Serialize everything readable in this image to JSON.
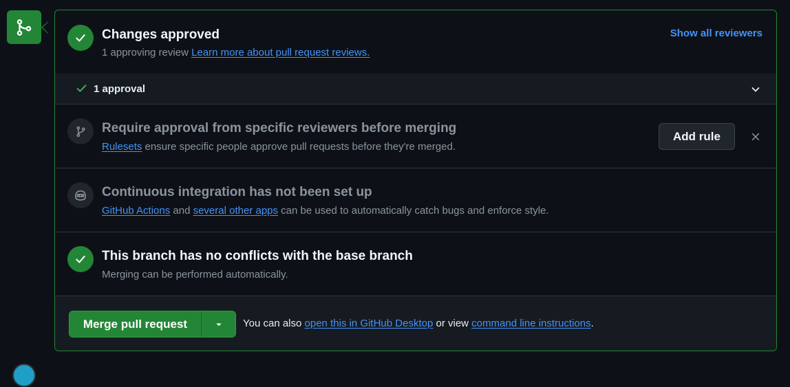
{
  "approved": {
    "title": "Changes approved",
    "subtitle": "1 approving review",
    "learn_more": "Learn more about pull request reviews.",
    "show_all": "Show all reviewers"
  },
  "approval_bar": {
    "label": "1 approval"
  },
  "rules": {
    "title": "Require approval from specific reviewers before merging",
    "link": "Rulesets",
    "text": "ensure specific people approve pull requests before they're merged.",
    "button": "Add rule"
  },
  "ci": {
    "title": "Continuous integration has not been set up",
    "link1": "GitHub Actions",
    "and": "and",
    "link2": "several other apps",
    "text": "can be used to automatically catch bugs and enforce style."
  },
  "conflicts": {
    "title": "This branch has no conflicts with the base branch",
    "subtitle": "Merging can be performed automatically."
  },
  "merge": {
    "button": "Merge pull request",
    "prefix": "You can also",
    "link1": "open this in GitHub Desktop",
    "middle": "or view",
    "link2": "command line instructions",
    "suffix": "."
  },
  "colors": {
    "success": "#238636",
    "link": "#4493f8",
    "background": "#0d1117",
    "surface": "#161b22",
    "border": "#30363d"
  },
  "icons": [
    "git-merge-icon",
    "check-icon",
    "git-branch-icon",
    "copilot-icon",
    "chevron-down-icon",
    "x-icon",
    "triangle-down-icon"
  ]
}
